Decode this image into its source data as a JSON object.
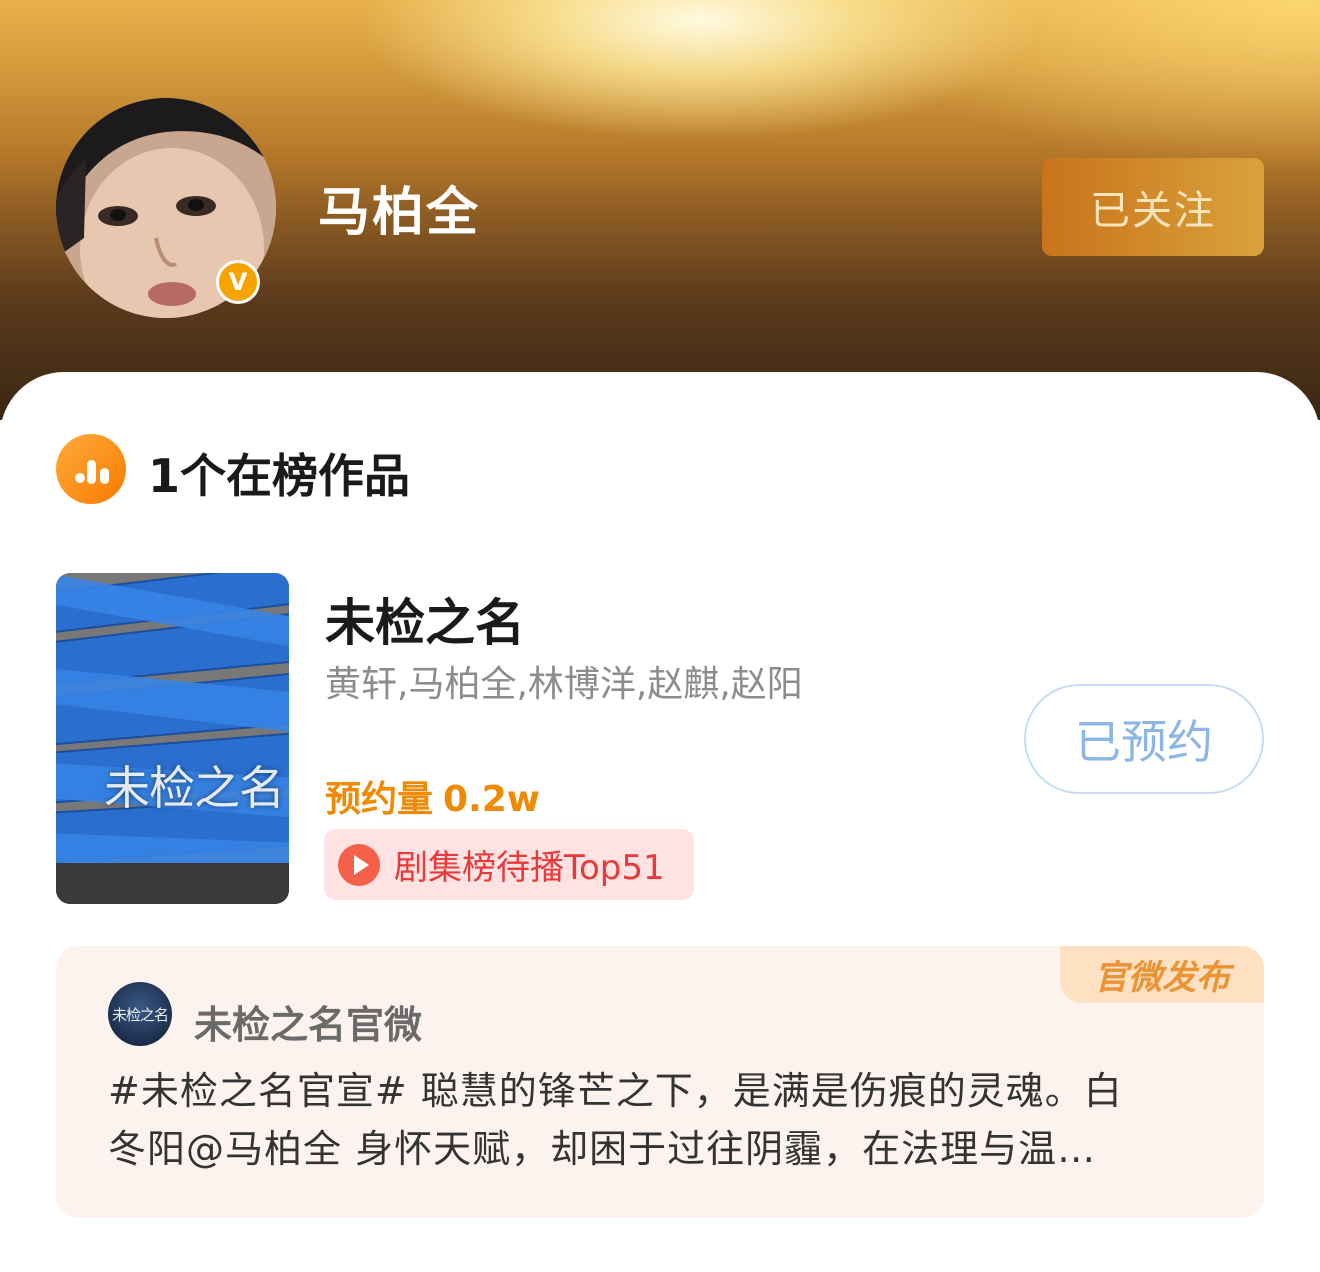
{
  "profile": {
    "name": "马柏全",
    "follow_label": "已关注",
    "verified_badge": "V"
  },
  "ranking": {
    "title": "1个在榜作品",
    "icon": "bar-chart-icon"
  },
  "work": {
    "title": "未检之名",
    "poster_text": "未检之名",
    "cast": "黄轩,马柏全,林博洋,赵麒,赵阳",
    "reserve_label": "预约量",
    "reserve_value": "0.2w",
    "rank_tag": "剧集榜待播Top51",
    "reserved_label": "已预约"
  },
  "post": {
    "official_tag": "官微发布",
    "avatar_text": "未检之名",
    "account_name": "未检之名官微",
    "text_line1": "#未检之名官宣# 聪慧的锋芒之下，是满是伤痕的灵魂。白",
    "text_line2": "冬阳@马柏全 身怀天赋，却困于过往阴霾，在法理与温…"
  },
  "colors": {
    "accent_orange": "#f08a00",
    "tag_red": "#e83a3a",
    "reserved_blue": "#8cb6e6"
  }
}
